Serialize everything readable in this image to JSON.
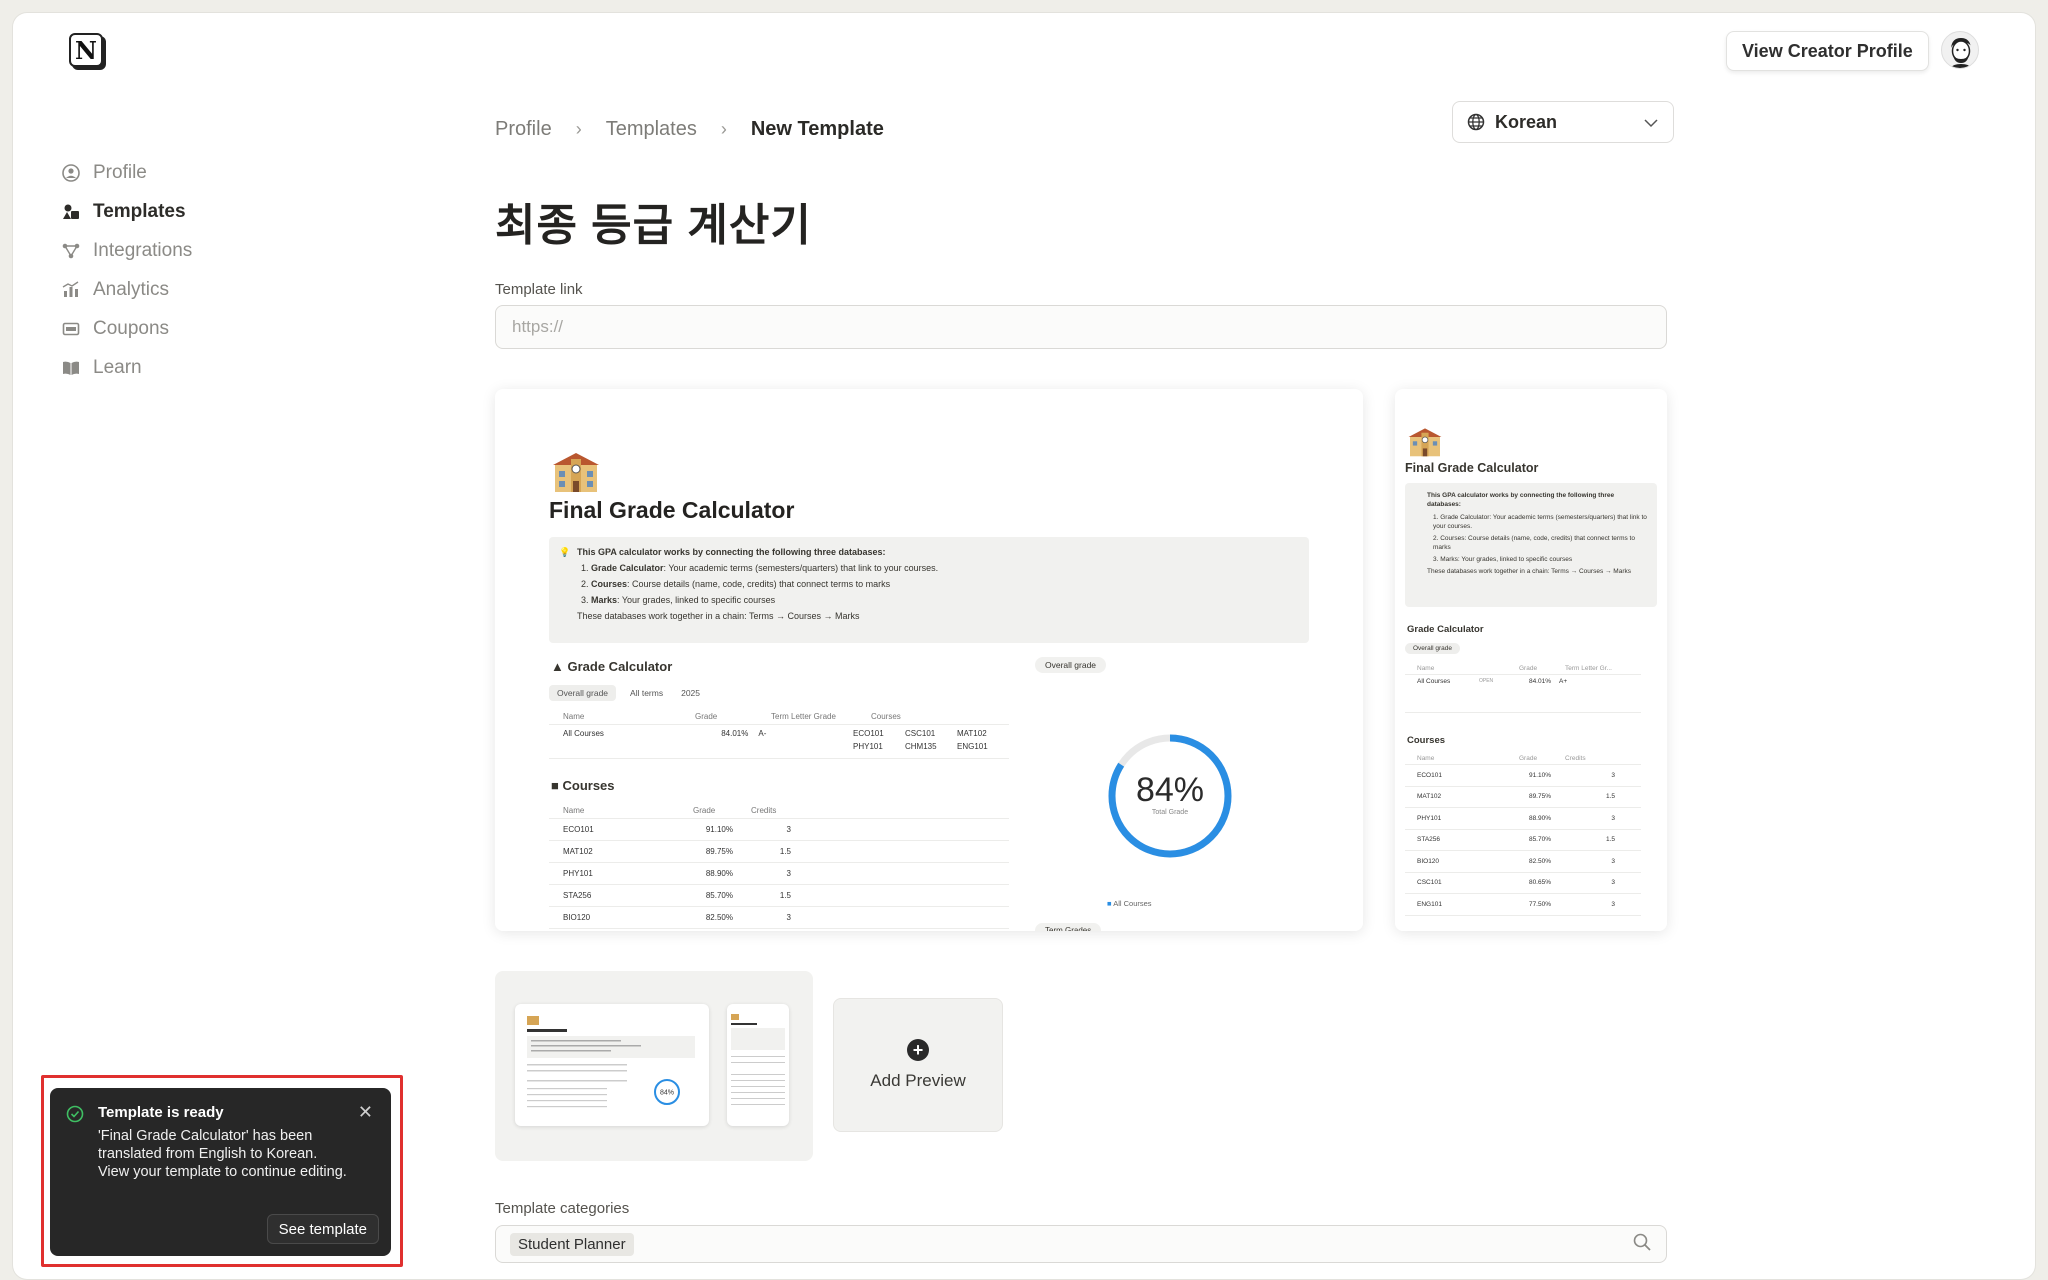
{
  "header": {
    "creator_button": "View Creator Profile"
  },
  "sidebar": {
    "items": [
      {
        "label": "Profile",
        "icon": "profile-icon"
      },
      {
        "label": "Templates",
        "icon": "templates-icon"
      },
      {
        "label": "Integrations",
        "icon": "integrations-icon"
      },
      {
        "label": "Analytics",
        "icon": "analytics-icon"
      },
      {
        "label": "Coupons",
        "icon": "coupons-icon"
      },
      {
        "label": "Learn",
        "icon": "book-icon"
      }
    ]
  },
  "breadcrumb": [
    "Profile",
    "Templates",
    "New Template"
  ],
  "language": {
    "selected": "Korean"
  },
  "page_title": "최종 등급 계산기",
  "template_link": {
    "label": "Template link",
    "placeholder": "https://"
  },
  "preview": {
    "title": "Final Grade Calculator",
    "callout_intro": "This GPA calculator works by connecting the following three databases:",
    "callout_items": [
      {
        "name": "Grade Calculator",
        "desc": ": Your academic terms (semesters/quarters) that link to your courses."
      },
      {
        "name": "Courses",
        "desc": ": Course details (name, code, credits) that connect terms to marks"
      },
      {
        "name": "Marks",
        "desc": ": Your grades, linked to specific courses"
      }
    ],
    "callout_outro": "These databases work together in a chain: Terms → Courses → Marks",
    "grade_section": "Grade Calculator",
    "views": [
      "Overall grade",
      "All terms",
      "2025"
    ],
    "grade_cols": [
      "Name",
      "Grade",
      "Term Letter Grade",
      "Courses"
    ],
    "grade_row": {
      "name": "All Courses",
      "grade": "84.01%",
      "letter": "A-",
      "courses": [
        "ECO101",
        "CSC101",
        "MAT102",
        "PHY101",
        "CHM135",
        "ENG101"
      ]
    },
    "courses_section": "Courses",
    "course_cols": [
      "Name",
      "Grade",
      "Credits"
    ],
    "courses": [
      {
        "name": "ECO101",
        "grade": "91.10%",
        "credits": "3"
      },
      {
        "name": "MAT102",
        "grade": "89.75%",
        "credits": "1.5"
      },
      {
        "name": "PHY101",
        "grade": "88.90%",
        "credits": "3"
      },
      {
        "name": "STA256",
        "grade": "85.70%",
        "credits": "1.5"
      },
      {
        "name": "BIO120",
        "grade": "82.50%",
        "credits": "3"
      }
    ],
    "chart_tag": "Overall grade",
    "gauge_value": "84%",
    "gauge_fraction": 0.84,
    "gauge_sub": "Total Grade",
    "legend": "All Courses",
    "term_grades": "Term Grades"
  },
  "preview_small": {
    "title": "Final Grade Calculator",
    "callout_intro": "This GPA calculator works by connecting the following three databases:",
    "items": [
      "Grade Calculator: Your academic terms (semesters/quarters) that link to your courses.",
      "Courses: Course details (name, code, credits) that connect terms to marks",
      "Marks: Your grades, linked to specific courses"
    ],
    "outro": "These databases work together in a chain: Terms → Courses → Marks",
    "grade_section": "Grade Calculator",
    "view": "Overall grade",
    "cols": [
      "Name",
      "Grade",
      "Term Letter Gr..."
    ],
    "row": {
      "name": "All Courses",
      "open": "OPEN",
      "grade": "84.01%",
      "letter": "A+"
    },
    "courses_section": "Courses",
    "course_cols": [
      "Name",
      "Grade",
      "Credits"
    ],
    "courses": [
      {
        "name": "ECO101",
        "grade": "91.10%",
        "credits": "3"
      },
      {
        "name": "MAT102",
        "grade": "89.75%",
        "credits": "1.5"
      },
      {
        "name": "PHY101",
        "grade": "88.90%",
        "credits": "3"
      },
      {
        "name": "STA256",
        "grade": "85.70%",
        "credits": "1.5"
      },
      {
        "name": "BIO120",
        "grade": "82.50%",
        "credits": "3"
      },
      {
        "name": "CSC101",
        "grade": "80.65%",
        "credits": "3"
      },
      {
        "name": "ENG101",
        "grade": "77.50%",
        "credits": "3"
      }
    ]
  },
  "add_preview": "Add Preview",
  "categories": {
    "label": "Template categories",
    "chips": [
      "Student Planner"
    ]
  },
  "toast": {
    "title": "Template is ready",
    "body": "'Final Grade Calculator' has been translated from English to Korean. View your template to continue editing.",
    "action": "See template"
  },
  "colors": {
    "accent": "#2a8ee3",
    "highlight": "#e0302f",
    "toast_bg": "#272727"
  }
}
